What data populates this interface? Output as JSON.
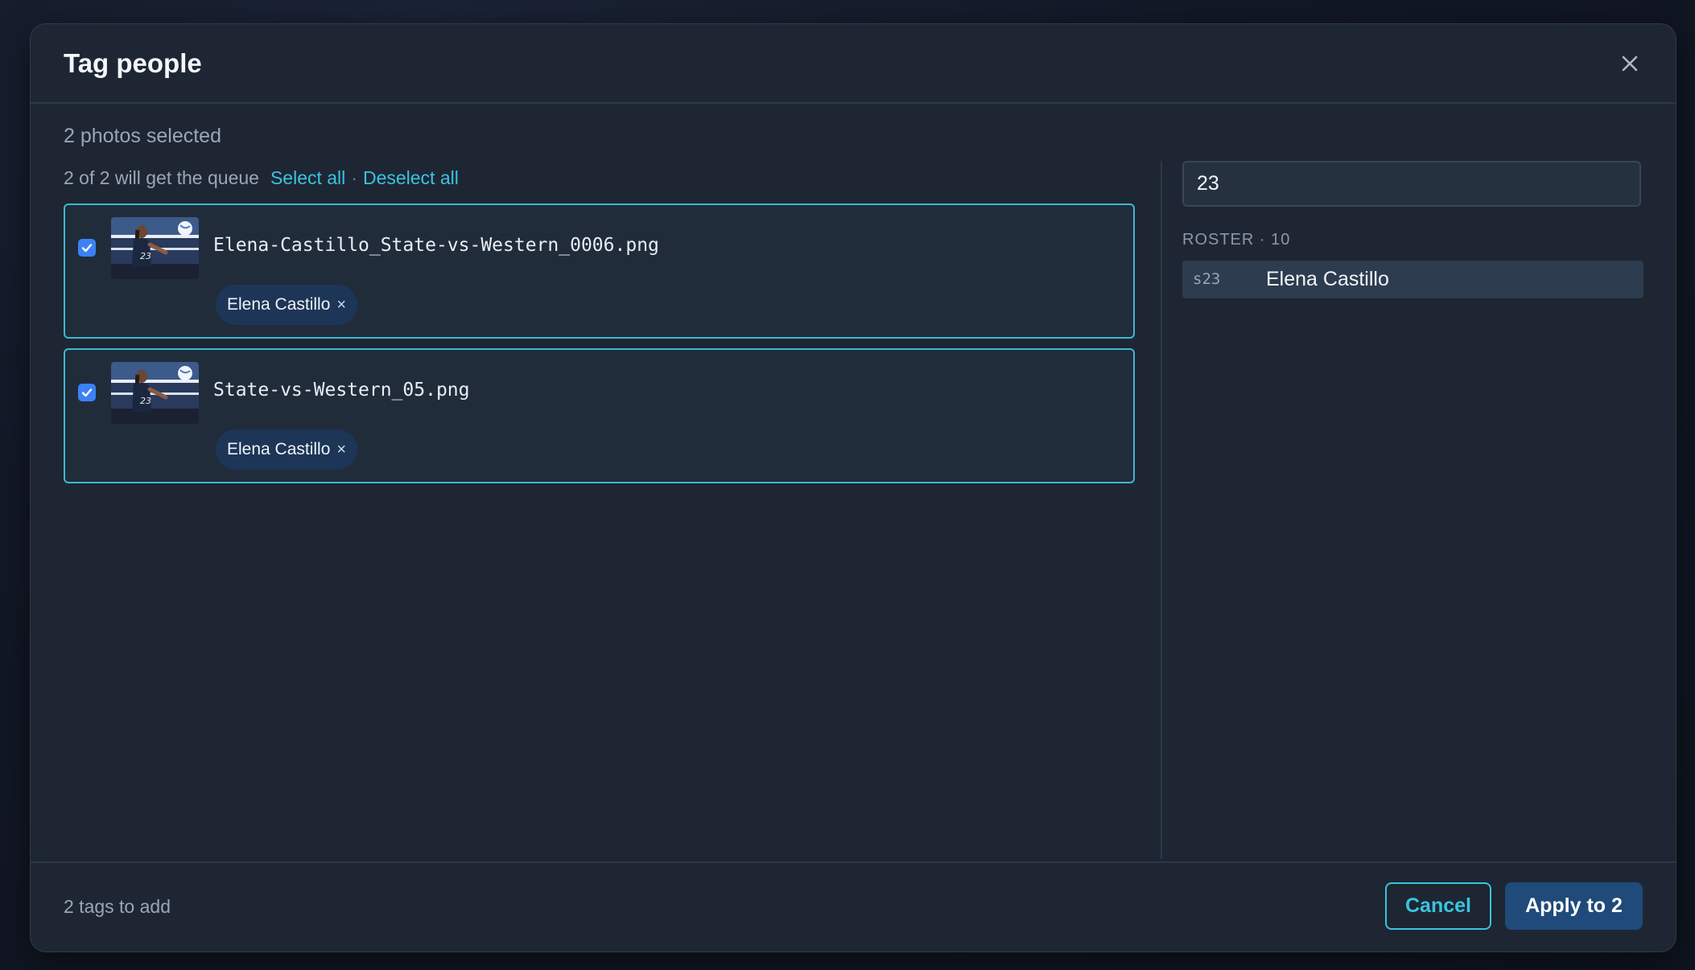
{
  "dialog": {
    "title": "Tag people",
    "close_icon": "close-icon"
  },
  "selection": {
    "summary": "2 photos selected",
    "queue_text": "2 of 2 will get the queue",
    "select_all": "Select all",
    "separator": "·",
    "deselect_all": "Deselect all"
  },
  "photos": [
    {
      "checked": true,
      "filename": "Elena-Castillo_State-vs-Western_0006.png",
      "tags": [
        {
          "label": "Elena Castillo",
          "remove": "×"
        }
      ]
    },
    {
      "checked": true,
      "filename": "State-vs-Western_05.png",
      "tags": [
        {
          "label": "Elena Castillo",
          "remove": "×"
        }
      ]
    }
  ],
  "search": {
    "value": "23"
  },
  "roster": {
    "heading": "ROSTER · 10",
    "results": [
      {
        "code": "s23",
        "name": "Elena Castillo"
      }
    ]
  },
  "footer": {
    "status": "2 tags to add",
    "cancel_label": "Cancel",
    "apply_label": "Apply to 2"
  },
  "colors": {
    "accent": "#39c4e0",
    "checkbox": "#3b82f6",
    "primary_button": "#1f4a7a",
    "chip": "#1d3557"
  }
}
